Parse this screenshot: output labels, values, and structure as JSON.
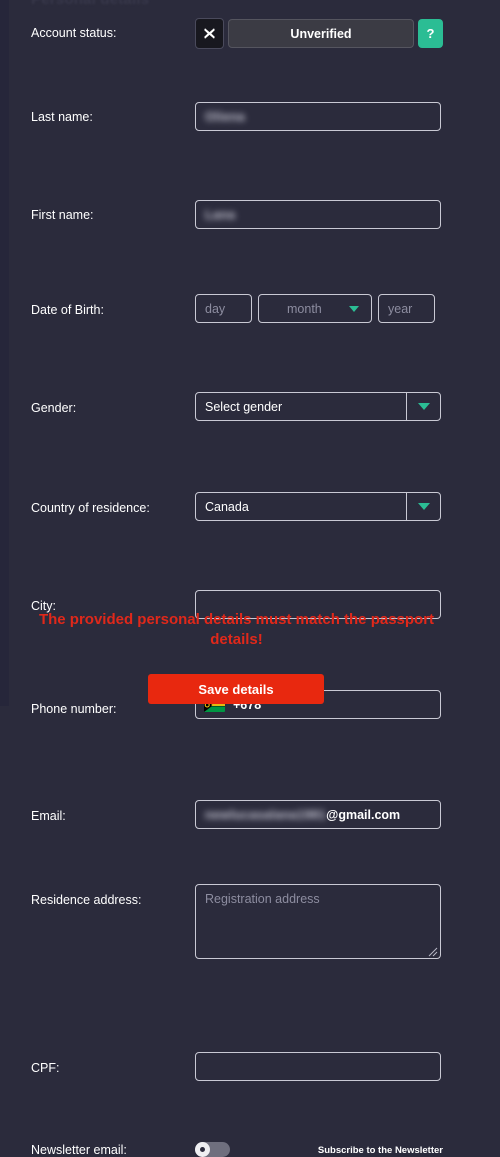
{
  "section": {
    "heading": "Personal details"
  },
  "colors": {
    "background": "#2b2b3c",
    "accent_teal": "#2bbd94",
    "danger_red": "#e8280f",
    "warning_red": "#e0281a",
    "field_border": "#c9c9d4",
    "placeholder": "#8d8da0"
  },
  "fields": {
    "account_status": {
      "label": "Account status:",
      "value": "Unverified",
      "x_icon": "close-x-icon",
      "help_label": "?"
    },
    "last_name": {
      "label": "Last name:",
      "value": "Oliena",
      "redacted": true
    },
    "first_name": {
      "label": "First name:",
      "value": "Lana",
      "redacted": true
    },
    "date_of_birth": {
      "label": "Date of Birth:",
      "day_placeholder": "day",
      "day_value": "",
      "month_placeholder": "month",
      "month_value": "",
      "year_placeholder": "year",
      "year_value": ""
    },
    "gender": {
      "label": "Gender:",
      "value": "Select gender"
    },
    "country": {
      "label": "Country of residence:",
      "value": "Canada"
    },
    "city": {
      "label": "City:",
      "value": ""
    },
    "phone": {
      "label": "Phone number:",
      "flag": "vanuatu-flag-icon",
      "dial_code": "+678",
      "value": ""
    },
    "email": {
      "label": "Email:",
      "redacted_local": "newlucasalana1981",
      "domain": "@gmail.com"
    },
    "residence_address": {
      "label": "Residence address:",
      "placeholder": "Registration address",
      "value": ""
    },
    "cpf": {
      "label": "CPF:",
      "value": ""
    },
    "newsletter": {
      "label": "Newsletter email:",
      "toggle_state": "off",
      "link_text": "Subscribe to the Newsletter"
    }
  },
  "footer": {
    "warning": "The provided personal details must match the passport details!",
    "save_label": "Save details"
  }
}
